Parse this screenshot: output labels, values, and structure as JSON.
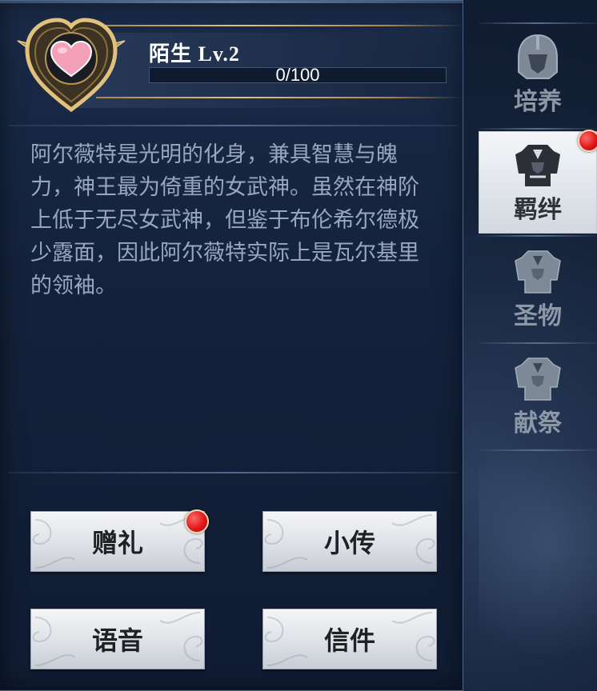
{
  "profile": {
    "name_level": "陌生 Lv.2",
    "xp_text": "0/100",
    "xp_progress": 0
  },
  "description": "阿尔薇特是光明的化身，兼具智慧与魄力，神王最为倚重的女武神。虽然在神阶上低于无尽女武神，但鉴于布伦希尔德极少露面，因此阿尔薇特实际上是瓦尔基里的领袖。",
  "buttons": {
    "gift": "赠礼",
    "bio": "小传",
    "voice": "语音",
    "letter": "信件"
  },
  "sidebar": {
    "tabs": [
      {
        "label": "培养",
        "icon": "helmet-icon",
        "active": false
      },
      {
        "label": "羁绊",
        "icon": "armor-icon",
        "active": true
      },
      {
        "label": "圣物",
        "icon": "armor-icon",
        "active": false
      },
      {
        "label": "献祭",
        "icon": "armor-icon",
        "active": false
      }
    ]
  },
  "colors": {
    "accent_gold": "#d8b870",
    "badge_red": "#e01818",
    "heart_pink": "#f3a0b8"
  }
}
